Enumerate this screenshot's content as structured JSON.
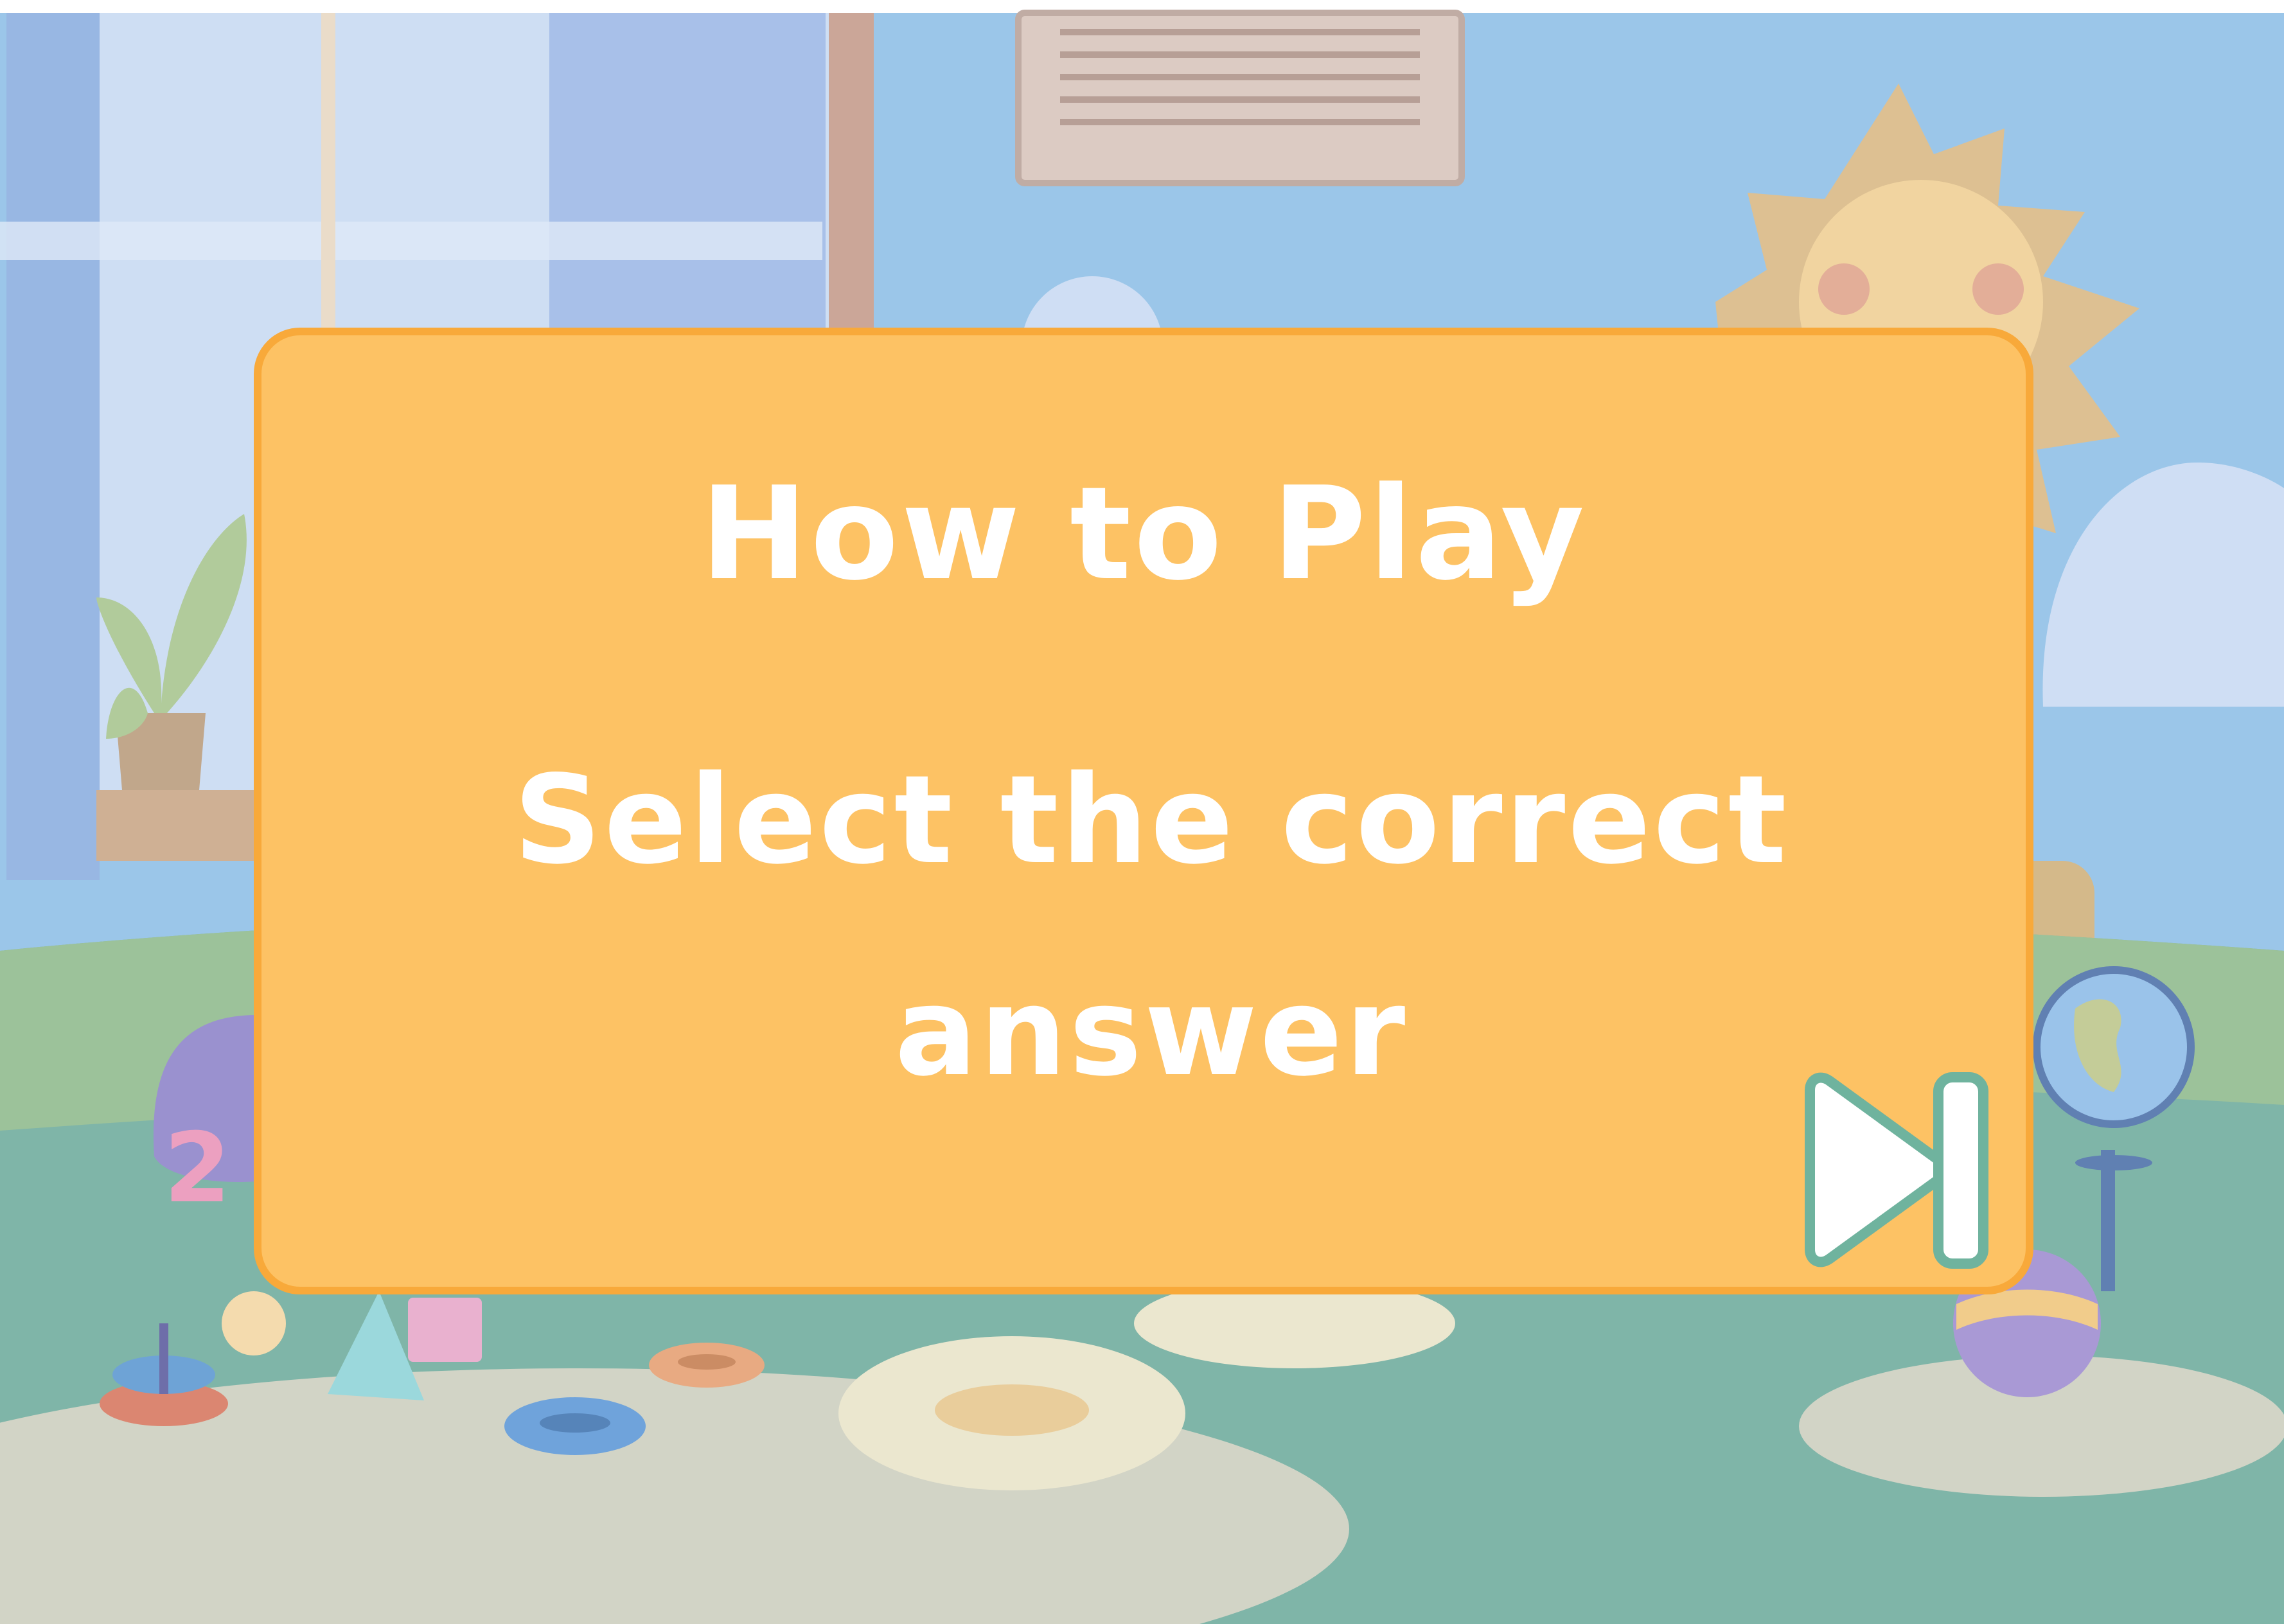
{
  "dialog": {
    "title": "How to Play",
    "instruction": "Select the correct answer"
  },
  "skip_button": {
    "icon": "skip-forward-icon"
  },
  "scene": {
    "setting": "playroom",
    "colors": {
      "dialog_fill": "#fdc264",
      "dialog_border": "#f8a93a",
      "dialog_text": "#ffffff",
      "skip_icon_fill": "#ffffff",
      "skip_icon_stroke": "#6fb39e",
      "wall": "#8ebfe6",
      "floor": "#6eab9d",
      "rug": "#cccfbf"
    }
  }
}
